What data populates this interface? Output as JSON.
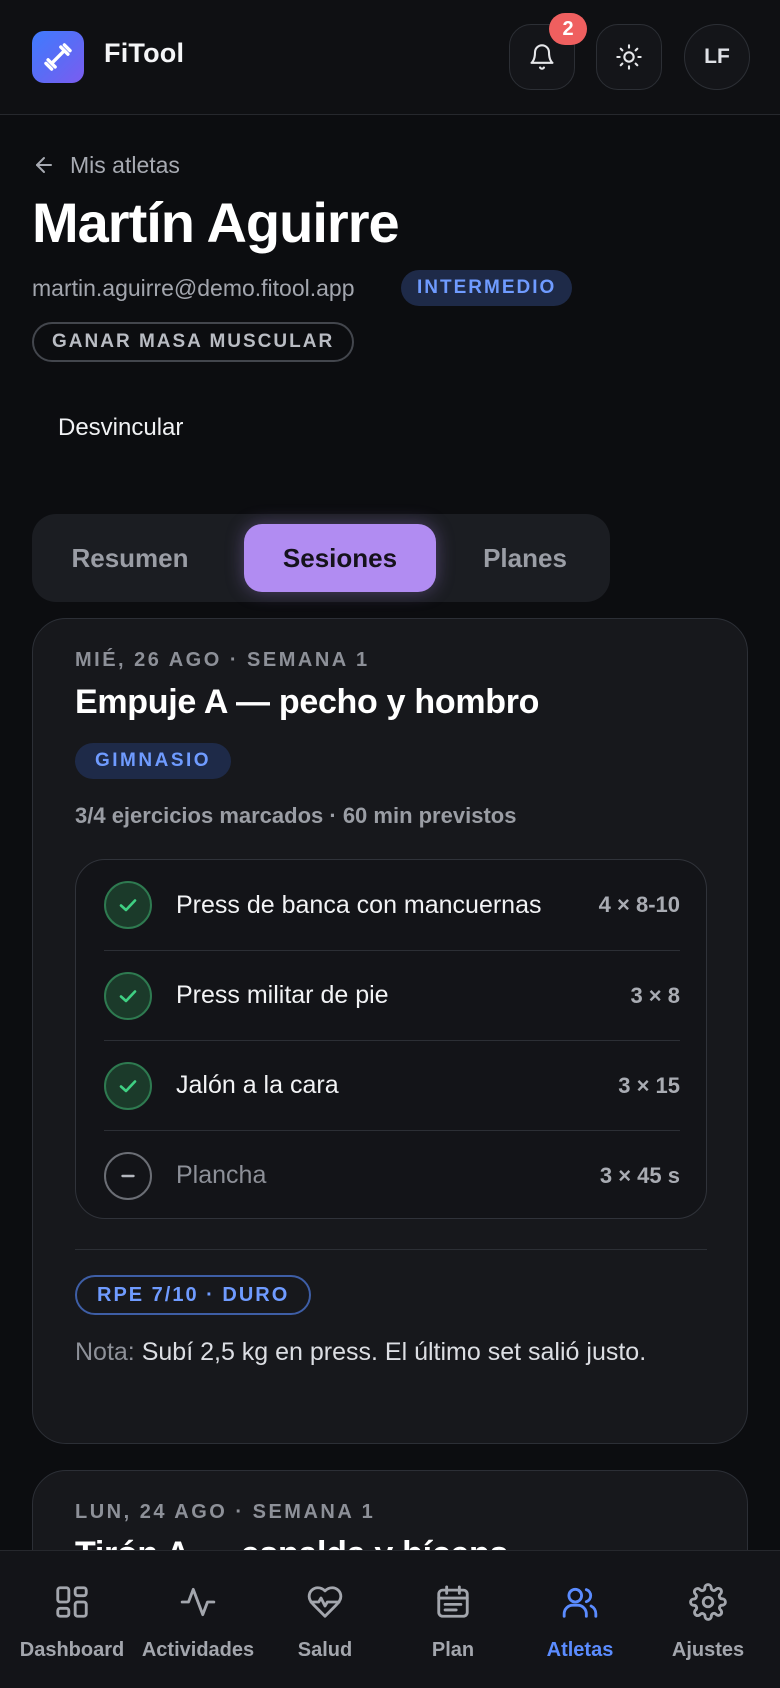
{
  "app": {
    "title": "FiTool"
  },
  "header": {
    "notification_count": "2",
    "avatar_initials": "LF"
  },
  "athlete": {
    "back_label": "Mis atletas",
    "name": "Martín Aguirre",
    "email": "martin.aguirre@demo.fitool.app",
    "level": "INTERMEDIO",
    "goal": "GANAR MASA MUSCULAR",
    "unlink_label": "Desvincular"
  },
  "tabs": [
    {
      "label": "Resumen",
      "active": false
    },
    {
      "label": "Sesiones",
      "active": true
    },
    {
      "label": "Planes",
      "active": false
    }
  ],
  "sessions": [
    {
      "date": "MIÉ, 26 AGO · SEMANA 1",
      "title": "Empuje A — pecho y hombro",
      "type": "GIMNASIO",
      "summary": "3/4 ejercicios marcados · 60 min previstos",
      "exercises": [
        {
          "name": "Press de banca con mancuernas",
          "sets": "4 × 8-10",
          "done": true
        },
        {
          "name": "Press militar de pie",
          "sets": "3 × 8",
          "done": true
        },
        {
          "name": "Jalón a la cara",
          "sets": "3 × 15",
          "done": true
        },
        {
          "name": "Plancha",
          "sets": "3 × 45 s",
          "done": false
        }
      ],
      "rpe": "RPE 7/10 · DURO",
      "note_label": "Nota:",
      "note_text": "Subí 2,5 kg en press. El último set salió justo."
    },
    {
      "date": "LUN, 24 AGO · SEMANA 1",
      "title": "Tirón A — espalda y bíceps"
    }
  ],
  "bottom_nav": [
    {
      "label": "Dashboard",
      "icon": "dashboard-icon",
      "active": false
    },
    {
      "label": "Actividades",
      "icon": "activity-icon",
      "active": false
    },
    {
      "label": "Salud",
      "icon": "heart-pulse-icon",
      "active": false
    },
    {
      "label": "Plan",
      "icon": "calendar-icon",
      "active": false
    },
    {
      "label": "Atletas",
      "icon": "users-icon",
      "active": true
    },
    {
      "label": "Ajustes",
      "icon": "settings-icon",
      "active": false
    }
  ],
  "colors": {
    "background": "#0c0d10",
    "accent_purple": "#b18cf2",
    "accent_blue": "#5b8cff",
    "success_green": "#34c77b",
    "badge_red": "#ef5f5f"
  }
}
